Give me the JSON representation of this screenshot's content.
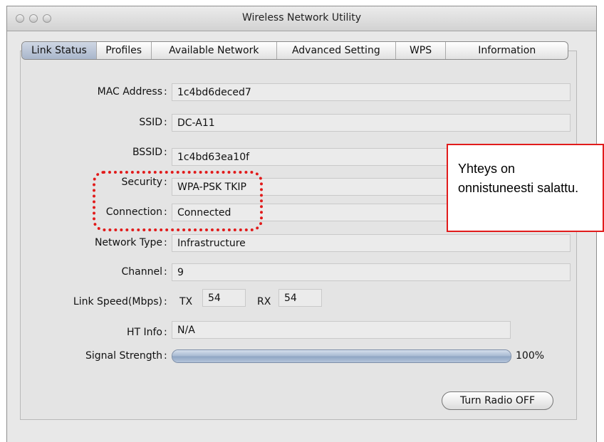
{
  "window": {
    "title": "Wireless Network Utility"
  },
  "tabs": [
    {
      "label": "Link Status",
      "active": true
    },
    {
      "label": "Profiles"
    },
    {
      "label": "Available Network"
    },
    {
      "label": "Advanced Setting"
    },
    {
      "label": "WPS"
    },
    {
      "label": "Information"
    }
  ],
  "status": {
    "mac_address": {
      "label": "MAC Address",
      "value": "1c4bd6deced7"
    },
    "ssid": {
      "label": "SSID",
      "value": "DC-A11"
    },
    "bssid": {
      "label": "BSSID",
      "value": "1c4bd63ea10f"
    },
    "security": {
      "label": "Security",
      "value": "WPA-PSK TKIP"
    },
    "connection": {
      "label": "Connection",
      "value": "Connected"
    },
    "network_type": {
      "label": "Network Type",
      "value": "Infrastructure"
    },
    "channel": {
      "label": "Channel",
      "value": "9"
    },
    "link_speed": {
      "label": "Link Speed(Mbps)",
      "tx_label": "TX",
      "tx_value": "54",
      "rx_label": "RX",
      "rx_value": "54"
    },
    "ht_info": {
      "label": "HT Info",
      "value": "N/A"
    },
    "signal_strength": {
      "label": "Signal Strength",
      "percent": "100%",
      "level": 1.0
    }
  },
  "buttons": {
    "turn_radio_off": "Turn Radio OFF"
  },
  "annotation": {
    "callout_text": "Yhteys on onnistuneesti salattu.",
    "color": "#e11b1b"
  }
}
